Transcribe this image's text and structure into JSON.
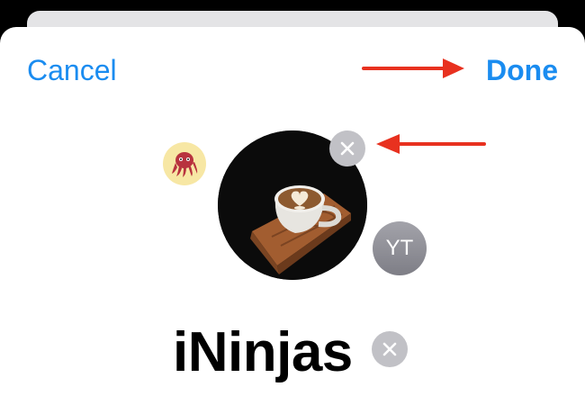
{
  "header": {
    "cancel_label": "Cancel",
    "done_label": "Done"
  },
  "avatars": {
    "memoji_icon": "octopus-memoji",
    "photo_icon": "coffee-latte-photo",
    "initials": "YT"
  },
  "group": {
    "name": "iNinjas"
  },
  "colors": {
    "accent": "#1a8cf0",
    "annotation_arrow": "#e8311f",
    "clear_button": "#c1c1c6"
  }
}
